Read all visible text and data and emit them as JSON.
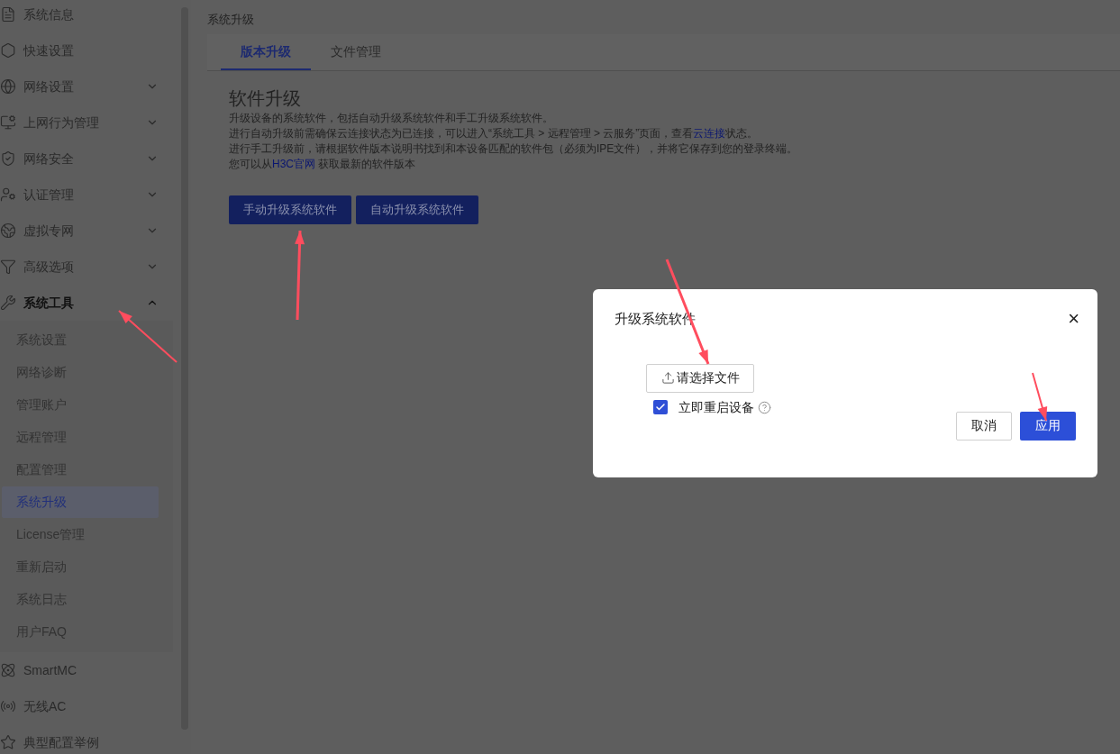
{
  "sidebar": {
    "items": [
      {
        "kind": "link",
        "label": "系统信息"
      },
      {
        "kind": "link",
        "label": "快速设置"
      },
      {
        "kind": "group",
        "label": "网络设置",
        "expanded": false
      },
      {
        "kind": "group",
        "label": "上网行为管理",
        "expanded": false
      },
      {
        "kind": "group",
        "label": "网络安全",
        "expanded": false
      },
      {
        "kind": "group",
        "label": "认证管理",
        "expanded": false
      },
      {
        "kind": "group",
        "label": "虚拟专网",
        "expanded": false
      },
      {
        "kind": "group",
        "label": "高级选项",
        "expanded": false
      },
      {
        "kind": "group",
        "label": "系统工具",
        "expanded": true,
        "children": [
          {
            "label": "系统设置",
            "selected": false
          },
          {
            "label": "网络诊断",
            "selected": false
          },
          {
            "label": "管理账户",
            "selected": false
          },
          {
            "label": "远程管理",
            "selected": false
          },
          {
            "label": "配置管理",
            "selected": false
          },
          {
            "label": "系统升级",
            "selected": true
          },
          {
            "label": "License管理",
            "selected": false
          },
          {
            "label": "重新启动",
            "selected": false
          },
          {
            "label": "系统日志",
            "selected": false
          },
          {
            "label": "用户FAQ",
            "selected": false
          }
        ]
      },
      {
        "kind": "link",
        "label": "SmartMC"
      },
      {
        "kind": "link",
        "label": "无线AC"
      },
      {
        "kind": "link",
        "label": "典型配置举例"
      }
    ]
  },
  "breadcrumb": "系统升级",
  "tabs": [
    {
      "label": "版本升级",
      "selected": true
    },
    {
      "label": "文件管理",
      "selected": false
    }
  ],
  "section": {
    "title": "软件升级",
    "lines": [
      {
        "parts": [
          {
            "text": "升级设备的系统软件，包括自动升级系统软件和手工升级系统软件。"
          }
        ]
      },
      {
        "parts": [
          {
            "text": "进行自动升级前需确保云连接状态为已连接，可以进入“系统工具 > 远程管理 > 云服务”页面，查看"
          },
          {
            "text": "云连接",
            "link": true
          },
          {
            "text": "状态。"
          }
        ]
      },
      {
        "parts": [
          {
            "text": "进行手工升级前，请根据软件版本说明书找到和本设备匹配的软件包（必须为IPE文件），并将它保存到您的登录终端。"
          }
        ]
      },
      {
        "parts": [
          {
            "text": "您可以从"
          },
          {
            "text": "H3C官网",
            "link": true
          },
          {
            "text": " 获取最新的软件版本"
          }
        ]
      }
    ],
    "buttons": [
      "手动升级系统软件",
      "自动升级系统软件"
    ]
  },
  "dialog": {
    "title": "升级系统软件",
    "close": "×",
    "file_button": "请选择文件",
    "reboot": {
      "label": "立即重启设备",
      "checked": true
    },
    "buttons": [
      {
        "label": "取消",
        "kind": "secondary"
      },
      {
        "label": "应用",
        "kind": "primary"
      }
    ]
  }
}
